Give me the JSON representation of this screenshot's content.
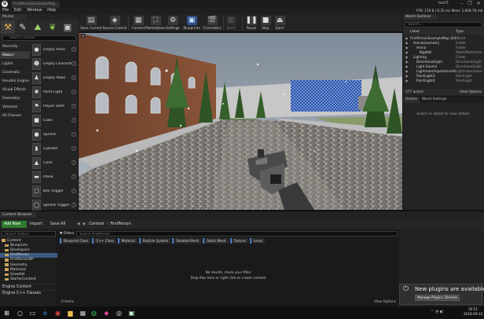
{
  "window": {
    "app_logo": "U",
    "tab_title": "FirstPersonExampleMap",
    "user": "test3",
    "controls": [
      "–",
      "❐",
      "✕"
    ]
  },
  "menu": [
    "File",
    "Edit",
    "Window",
    "Help"
  ],
  "viewport_stats": "FPS: 119.8 | 8.35 ms    Mem: 1,958.78 mb    Objs: 47,863",
  "modes": {
    "tab": "Modes",
    "search_placeholder": "Search Classes",
    "categories": [
      "Recently Placed",
      "Basic",
      "Lights",
      "Cinematic",
      "Visual Effects",
      "Geometry",
      "Volumes",
      "All Classes"
    ],
    "active_category": "Basic",
    "extra_categories": {
      "houdini": "Houdini Engine"
    },
    "placeables": [
      {
        "label": "Empty Actor",
        "icon": "sphere-icon"
      },
      {
        "label": "Empty Character",
        "icon": "character-icon"
      },
      {
        "label": "Empty Pawn",
        "icon": "pawn-icon"
      },
      {
        "label": "Point Light",
        "icon": "light-icon"
      },
      {
        "label": "Player Start",
        "icon": "player-start-icon"
      },
      {
        "label": "Cube",
        "icon": "cube-icon"
      },
      {
        "label": "Sphere",
        "icon": "sphere-icon"
      },
      {
        "label": "Cylinder",
        "icon": "cylinder-icon"
      },
      {
        "label": "Cone",
        "icon": "cone-icon"
      },
      {
        "label": "Plane",
        "icon": "plane-icon"
      },
      {
        "label": "Box Trigger",
        "icon": "box-trigger-icon"
      },
      {
        "label": "Sphere Trigger",
        "icon": "sphere-trigger-icon"
      }
    ]
  },
  "toolbar": {
    "buttons": [
      "Save Current",
      "Source Control",
      "Content",
      "Marketplace",
      "Settings",
      "Blueprints",
      "Cinematics",
      "Build",
      "Pause",
      "Stop",
      "Eject"
    ]
  },
  "outliner": {
    "tab": "World Outliner",
    "search_placeholder": "Search...",
    "col_label": "Label",
    "col_type": "Type",
    "rows": [
      {
        "label": "FirstPersonExampleMap (Editor)",
        "type": "World"
      },
      {
        "label": "ArenaGeometry",
        "type": "Folder"
      },
      {
        "label": "Arena",
        "type": "Folder"
      },
      {
        "label": "BigWall",
        "type": "StaticMeshActor"
      },
      {
        "label": "Lighting",
        "type": "Folder"
      },
      {
        "label": "DirectionalLight",
        "type": "DirectionalLight"
      },
      {
        "label": "Light Source",
        "type": "DirectionalLight"
      },
      {
        "label": "LightmassImportanceVolume",
        "type": "LightmassImpor"
      },
      {
        "label": "PointLight3",
        "type": "PointLight"
      },
      {
        "label": "PointLight4",
        "type": "PointLight"
      }
    ],
    "actor_count": "377 actors",
    "view_options": "View Options"
  },
  "details": {
    "tabs": [
      "Details",
      "World Settings"
    ],
    "empty_msg": "Select an object to view details."
  },
  "content_browser": {
    "tab": "Content Browser",
    "add_new": "Add New",
    "import": "Import",
    "save_all": "Save All",
    "path": [
      "Content",
      "FirstPerson"
    ],
    "search_folders": "Search Folders",
    "filters": "Filters",
    "search_product": "Search FirstPerson",
    "chips": [
      "Blueprint Class",
      "C++ Class",
      "Material",
      "Particle System",
      "Skeletal Mesh",
      "Static Mesh",
      "Texture",
      "Level"
    ],
    "folders": [
      {
        "label": "Content",
        "depth": 0
      },
      {
        "label": "Blueprints",
        "depth": 1
      },
      {
        "label": "Developers",
        "depth": 1
      },
      {
        "label": "FirstPerson",
        "depth": 1,
        "selected": true
      },
      {
        "label": "FirstPersonBP",
        "depth": 1
      },
      {
        "label": "Geometry",
        "depth": 1
      },
      {
        "label": "Materials",
        "depth": 1
      },
      {
        "label": "Snowfall",
        "depth": 1
      },
      {
        "label": "StarterContent",
        "depth": 1
      }
    ],
    "sections": [
      "Engine Content",
      "Engine C++ Classes"
    ],
    "no_results_1": "No results, check your filter.",
    "no_results_2": "Drop files here or right click to create content.",
    "item_count": "0 items",
    "view_options": "View Options"
  },
  "notification": {
    "title": "New plugins are available",
    "manage": "Manage Plugins...",
    "dismiss": "Dismiss"
  },
  "taskbar": {
    "time": "20:51",
    "date": "2018-09-22"
  },
  "colors": {
    "accent_green": "#2e7a2e",
    "selection_blue": "#3d5a80",
    "folder_yellow": "#c9a45a"
  }
}
